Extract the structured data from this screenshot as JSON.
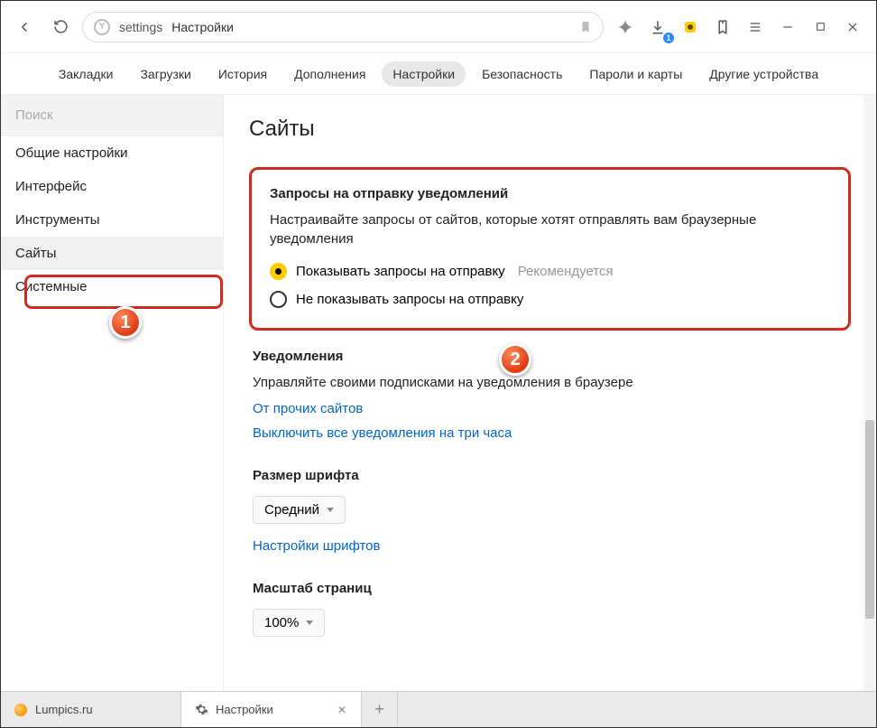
{
  "titlebar": {
    "address_prefix": "settings",
    "address_title": "Настройки",
    "download_badge": "1"
  },
  "navtabs": [
    "Закладки",
    "Загрузки",
    "История",
    "Дополнения",
    "Настройки",
    "Безопасность",
    "Пароли и карты",
    "Другие устройства"
  ],
  "sidebar": {
    "search_placeholder": "Поиск",
    "items": [
      "Общие настройки",
      "Интерфейс",
      "Инструменты",
      "Сайты",
      "Системные"
    ]
  },
  "page": {
    "title": "Сайты"
  },
  "notif_req": {
    "title": "Запросы на отправку уведомлений",
    "desc": "Настраивайте запросы от сайтов, которые хотят отправлять вам браузерные уведомления",
    "opt_show": "Показывать запросы на отправку",
    "opt_show_hint": "Рекомендуется",
    "opt_hide": "Не показывать запросы на отправку"
  },
  "notif": {
    "title": "Уведомления",
    "desc": "Управляйте своими подписками на уведомления в браузере",
    "link_other": "От прочих сайтов",
    "link_mute": "Выключить все уведомления на три часа"
  },
  "font": {
    "title": "Размер шрифта",
    "value": "Средний",
    "link": "Настройки шрифтов"
  },
  "zoom": {
    "title": "Масштаб страниц",
    "value": "100%"
  },
  "tabs": [
    "Lumpics.ru",
    "Настройки"
  ],
  "badges": {
    "b1": "1",
    "b2": "2"
  }
}
